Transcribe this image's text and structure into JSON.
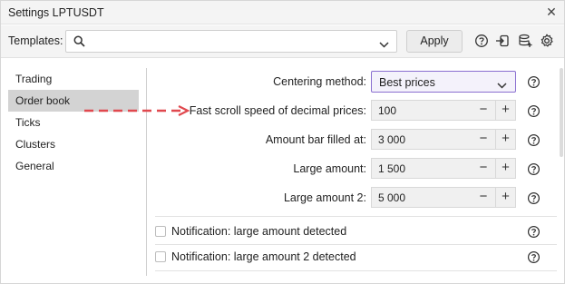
{
  "window": {
    "title": "Settings LPTUSDT"
  },
  "toolbar": {
    "templates_label": "Templates:",
    "templates_value": "",
    "apply_label": "Apply"
  },
  "sidebar": {
    "items": [
      {
        "label": "Trading",
        "active": false
      },
      {
        "label": "Order book",
        "active": true
      },
      {
        "label": "Ticks",
        "active": false
      },
      {
        "label": "Clusters",
        "active": false
      },
      {
        "label": "General",
        "active": false
      }
    ]
  },
  "settings": {
    "centering": {
      "label": "Centering method:",
      "value": "Best prices"
    },
    "fast_scroll": {
      "label": "Fast scroll speed of decimal prices:",
      "value": "100"
    },
    "amount_bar": {
      "label": "Amount bar filled at:",
      "value": "3 000"
    },
    "large_amount": {
      "label": "Large amount:",
      "value": "1 500"
    },
    "large_amount_2": {
      "label": "Large amount 2:",
      "value": "5 000"
    },
    "notif_large": {
      "label": "Notification: large amount detected",
      "checked": false
    },
    "notif_large_2": {
      "label": "Notification: large amount 2 detected",
      "checked": false
    }
  },
  "stepper": {
    "minus": "−",
    "plus": "+"
  },
  "colors": {
    "accent": "#8a6fd0",
    "annotation_arrow": "#e0484e",
    "active_item_bg": "#d3d3d3"
  },
  "icons": [
    "close-icon",
    "search-icon",
    "chevron-down-icon",
    "help-icon",
    "import-icon",
    "database-add-icon",
    "gear-icon"
  ]
}
